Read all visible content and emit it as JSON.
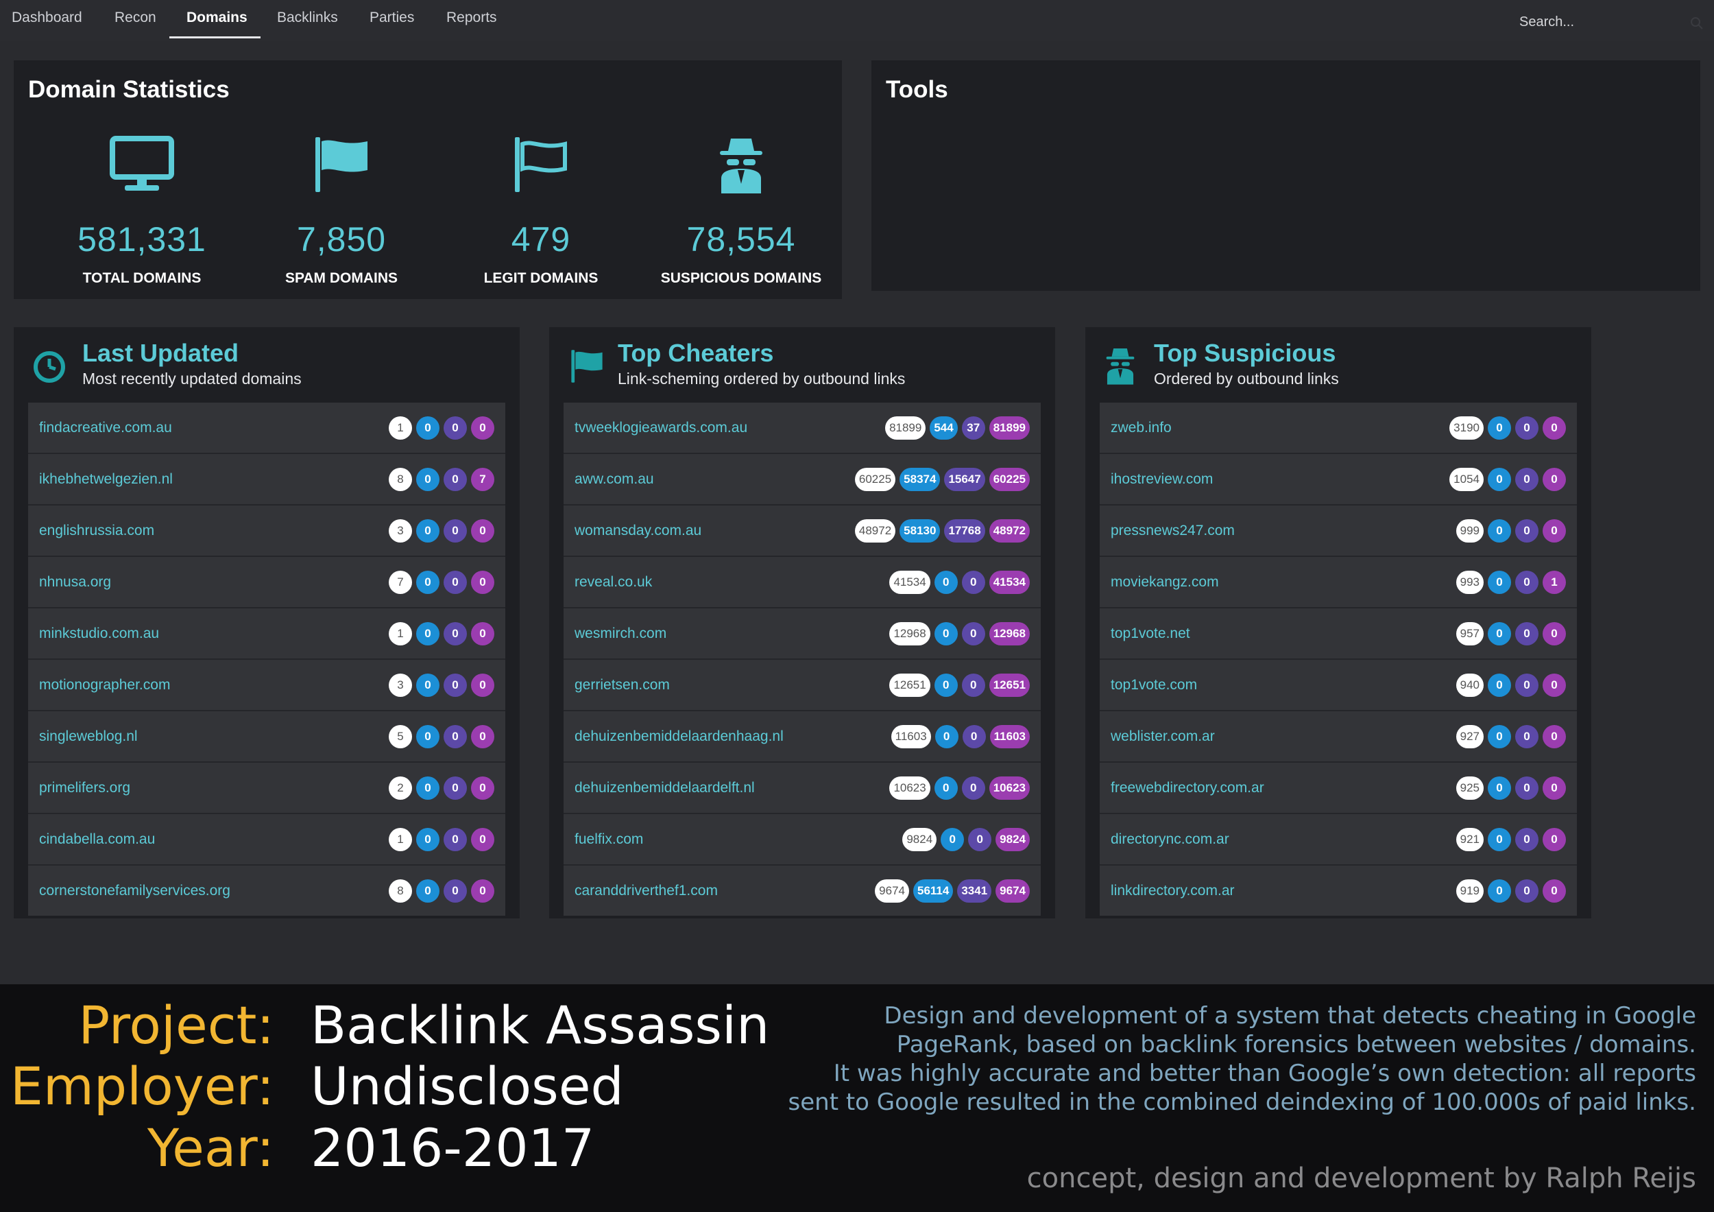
{
  "nav": {
    "items": [
      "Dashboard",
      "Recon",
      "Domains",
      "Backlinks",
      "Parties",
      "Reports"
    ],
    "active": "Domains",
    "search_placeholder": "Search..."
  },
  "stats": {
    "title": "Domain Statistics",
    "items": [
      {
        "value": "581,331",
        "label": "TOTAL DOMAINS",
        "icon": "monitor-icon"
      },
      {
        "value": "7,850",
        "label": "SPAM DOMAINS",
        "icon": "flag-filled-icon"
      },
      {
        "value": "479",
        "label": "LEGIT DOMAINS",
        "icon": "flag-outline-icon"
      },
      {
        "value": "78,554",
        "label": "SUSPICIOUS DOMAINS",
        "icon": "spy-icon"
      }
    ]
  },
  "tools": {
    "title": "Tools"
  },
  "colors": {
    "accent": "#5ccbd7",
    "blue": "#1c8fd6",
    "indigo": "#5c49a8",
    "purple": "#9b3db0",
    "gold": "#f2b632"
  },
  "last_updated": {
    "title": "Last Updated",
    "subtitle": "Most recently updated domains",
    "rows": [
      {
        "domain": "findacreative.com.au",
        "a": "1",
        "b": "0",
        "c": "0",
        "d": "0"
      },
      {
        "domain": "ikhebhetwelgezien.nl",
        "a": "8",
        "b": "0",
        "c": "0",
        "d": "7"
      },
      {
        "domain": "englishrussia.com",
        "a": "3",
        "b": "0",
        "c": "0",
        "d": "0"
      },
      {
        "domain": "nhnusa.org",
        "a": "7",
        "b": "0",
        "c": "0",
        "d": "0"
      },
      {
        "domain": "minkstudio.com.au",
        "a": "1",
        "b": "0",
        "c": "0",
        "d": "0"
      },
      {
        "domain": "motionographer.com",
        "a": "3",
        "b": "0",
        "c": "0",
        "d": "0"
      },
      {
        "domain": "singleweblog.nl",
        "a": "5",
        "b": "0",
        "c": "0",
        "d": "0"
      },
      {
        "domain": "primelifers.org",
        "a": "2",
        "b": "0",
        "c": "0",
        "d": "0"
      },
      {
        "domain": "cindabella.com.au",
        "a": "1",
        "b": "0",
        "c": "0",
        "d": "0"
      },
      {
        "domain": "cornerstonefamilyservices.org",
        "a": "8",
        "b": "0",
        "c": "0",
        "d": "0"
      }
    ]
  },
  "top_cheaters": {
    "title": "Top Cheaters",
    "subtitle": "Link-scheming ordered by outbound links",
    "rows": [
      {
        "domain": "tvweeklogieawards.com.au",
        "a": "81899",
        "b": "544",
        "c": "37",
        "d": "81899"
      },
      {
        "domain": "aww.com.au",
        "a": "60225",
        "b": "58374",
        "c": "15647",
        "d": "60225"
      },
      {
        "domain": "womansday.com.au",
        "a": "48972",
        "b": "58130",
        "c": "17768",
        "d": "48972"
      },
      {
        "domain": "reveal.co.uk",
        "a": "41534",
        "b": "0",
        "c": "0",
        "d": "41534"
      },
      {
        "domain": "wesmirch.com",
        "a": "12968",
        "b": "0",
        "c": "0",
        "d": "12968"
      },
      {
        "domain": "gerrietsen.com",
        "a": "12651",
        "b": "0",
        "c": "0",
        "d": "12651"
      },
      {
        "domain": "dehuizenbemiddelaardenhaag.nl",
        "a": "11603",
        "b": "0",
        "c": "0",
        "d": "11603"
      },
      {
        "domain": "dehuizenbemiddelaardelft.nl",
        "a": "10623",
        "b": "0",
        "c": "0",
        "d": "10623"
      },
      {
        "domain": "fuelfix.com",
        "a": "9824",
        "b": "0",
        "c": "0",
        "d": "9824"
      },
      {
        "domain": "caranddriverthef1.com",
        "a": "9674",
        "b": "56114",
        "c": "3341",
        "d": "9674"
      }
    ]
  },
  "top_suspicious": {
    "title": "Top Suspicious",
    "subtitle": "Ordered by outbound links",
    "rows": [
      {
        "domain": "zweb.info",
        "a": "3190",
        "b": "0",
        "c": "0",
        "d": "0"
      },
      {
        "domain": "ihostreview.com",
        "a": "1054",
        "b": "0",
        "c": "0",
        "d": "0"
      },
      {
        "domain": "pressnews247.com",
        "a": "999",
        "b": "0",
        "c": "0",
        "d": "0"
      },
      {
        "domain": "moviekangz.com",
        "a": "993",
        "b": "0",
        "c": "0",
        "d": "1"
      },
      {
        "domain": "top1vote.net",
        "a": "957",
        "b": "0",
        "c": "0",
        "d": "0"
      },
      {
        "domain": "top1vote.com",
        "a": "940",
        "b": "0",
        "c": "0",
        "d": "0"
      },
      {
        "domain": "weblister.com.ar",
        "a": "927",
        "b": "0",
        "c": "0",
        "d": "0"
      },
      {
        "domain": "freewebdirectory.com.ar",
        "a": "925",
        "b": "0",
        "c": "0",
        "d": "0"
      },
      {
        "domain": "directorync.com.ar",
        "a": "921",
        "b": "0",
        "c": "0",
        "d": "0"
      },
      {
        "domain": "linkdirectory.com.ar",
        "a": "919",
        "b": "0",
        "c": "0",
        "d": "0"
      }
    ]
  },
  "footer": {
    "project_label": "Project:",
    "project_value": "Backlink Assassin",
    "employer_label": "Employer:",
    "employer_value": "Undisclosed",
    "year_label": "Year:",
    "year_value": "2016-2017",
    "description": [
      "Design and development of a system that detects cheating in Google",
      "PageRank, based on backlink forensics between websites / domains.",
      "It was highly accurate and better than Google’s own detection: all reports",
      "sent to Google resulted in the combined deindexing of 100.000s of paid links."
    ],
    "credit": "concept, design and development by Ralph Reijs"
  }
}
